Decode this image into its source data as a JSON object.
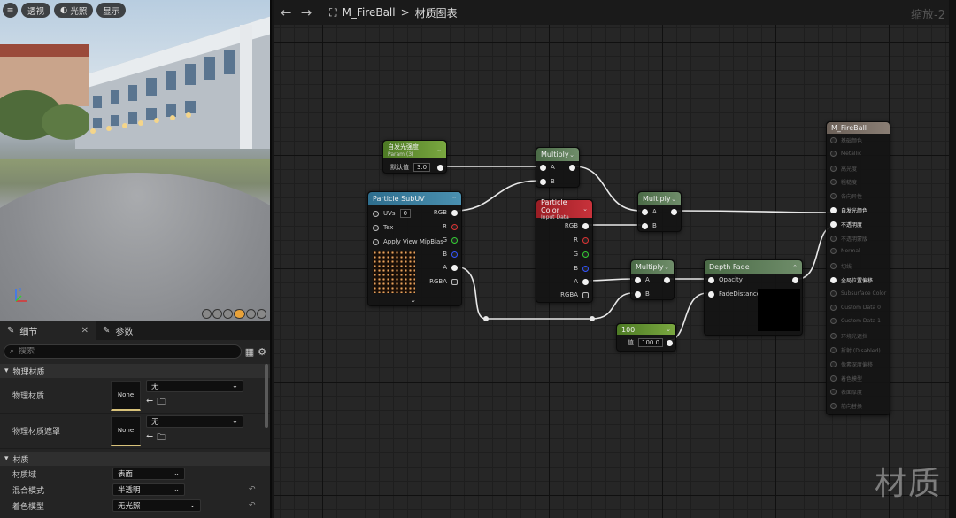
{
  "viewport": {
    "buttons": [
      "透视",
      "光照",
      "显示"
    ],
    "accent": "#e8a23a"
  },
  "details": {
    "tabs": [
      {
        "label": "细节"
      },
      {
        "label": "参数"
      }
    ],
    "search_placeholder": "搜索",
    "sections": {
      "physical": {
        "title": "物理材质",
        "rows": [
          {
            "label": "物理材质",
            "thumb": "None",
            "value": "无"
          },
          {
            "label": "物理材质遮罩",
            "thumb": "None",
            "value": "无"
          }
        ]
      },
      "material": {
        "title": "材质",
        "rows": [
          {
            "label": "材质域",
            "value": "表面"
          },
          {
            "label": "混合模式",
            "value": "半透明"
          },
          {
            "label": "着色模型",
            "value": "无光照"
          }
        ]
      }
    }
  },
  "graph": {
    "crumb_root": "M_FireBall",
    "crumb_sep": ">",
    "crumb_leaf": "材质图表",
    "zoom": "缩放-2",
    "watermark": "材质"
  },
  "nodes": {
    "param": {
      "title": "自发光强度",
      "subtitle": "Param (3)",
      "field_label": "默认值",
      "field_value": "3.0",
      "color": "#5b8a2e"
    },
    "multiply1": {
      "title": "Multiply",
      "pins_in": [
        "A",
        "B"
      ]
    },
    "multiply2": {
      "title": "Multiply",
      "pins_in": [
        "A",
        "B"
      ]
    },
    "multiply3": {
      "title": "Multiply",
      "pins_in": [
        "A",
        "B"
      ]
    },
    "subuv": {
      "title": "Particle SubUV",
      "inputs": [
        "UVs",
        "Tex",
        "Apply View MipBias"
      ],
      "uvs_value": "0",
      "outputs": [
        "RGB",
        "R",
        "G",
        "B",
        "A",
        "RGBA"
      ]
    },
    "pcolor": {
      "title": "Particle Color",
      "subtitle": "Input Data",
      "outputs": [
        "RGB",
        "R",
        "G",
        "B",
        "A",
        "RGBA"
      ],
      "color": "#b3242c"
    },
    "const100": {
      "title": "100",
      "field_label": "值",
      "field_value": "100.0"
    },
    "depthfade": {
      "title": "Depth Fade",
      "inputs": [
        "Opacity",
        "FadeDistance"
      ]
    },
    "result": {
      "title": "M_FireBall",
      "pins": [
        {
          "label": "基础颜色",
          "active": false
        },
        {
          "label": "Metallic",
          "active": false
        },
        {
          "label": "高光度",
          "active": false
        },
        {
          "label": "粗糙度",
          "active": false
        },
        {
          "label": "各向异性",
          "active": false
        },
        {
          "label": "自发光颜色",
          "active": true
        },
        {
          "label": "不透明度",
          "active": true
        },
        {
          "label": "不透明蒙版",
          "active": false
        },
        {
          "label": "Normal",
          "active": false
        },
        {
          "label": "切线",
          "active": false
        },
        {
          "label": "全局位置偏移",
          "active": true
        },
        {
          "label": "Subsurface Color",
          "active": false
        },
        {
          "label": "Custom Data 0",
          "active": false
        },
        {
          "label": "Custom Data 1",
          "active": false
        },
        {
          "label": "环境光遮挡",
          "active": false
        },
        {
          "label": "折射 (Disabled)",
          "active": false
        },
        {
          "label": "像素深度偏移",
          "active": false
        },
        {
          "label": "着色模型",
          "active": false
        },
        {
          "label": "表面厚度",
          "active": false
        },
        {
          "label": "前向替换",
          "active": false
        }
      ]
    }
  }
}
